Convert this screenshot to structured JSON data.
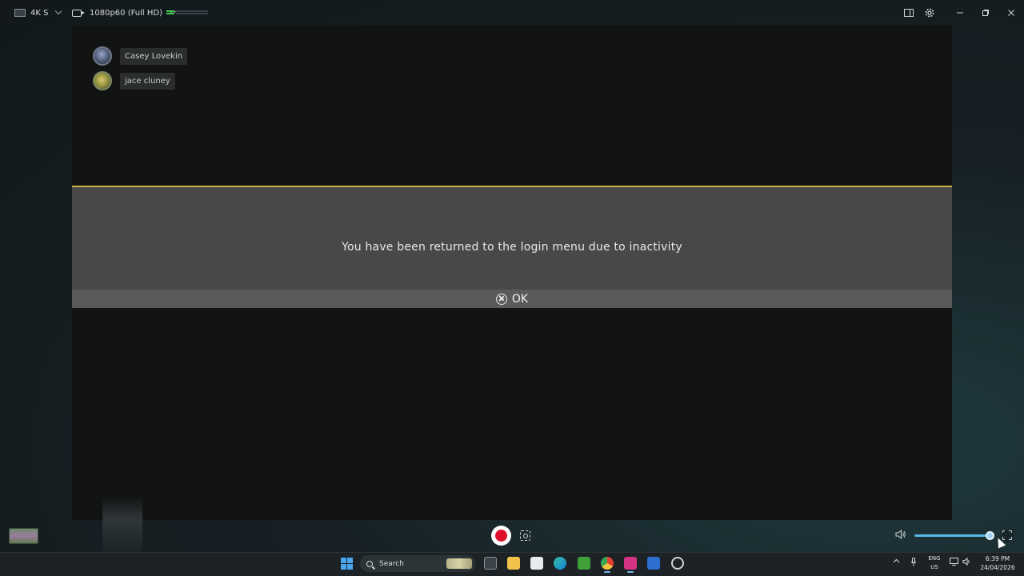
{
  "topbar": {
    "device_label": "4K S",
    "resolution_label": "1080p60 (Full HD)"
  },
  "game": {
    "players": [
      {
        "name": "Casey Lovekin"
      },
      {
        "name": "jace cluney"
      }
    ],
    "dialog": {
      "message": "You have been returned to the login menu due to inactivity",
      "ok_label": "OK",
      "accent_color": "#c7b24a"
    }
  },
  "controls": {
    "volume_fraction": 0.94
  },
  "taskbar": {
    "search_label": "Search",
    "lang_line1": "ENG",
    "lang_line2": "US",
    "time": "6:39 PM",
    "date": "24/04/2026"
  }
}
